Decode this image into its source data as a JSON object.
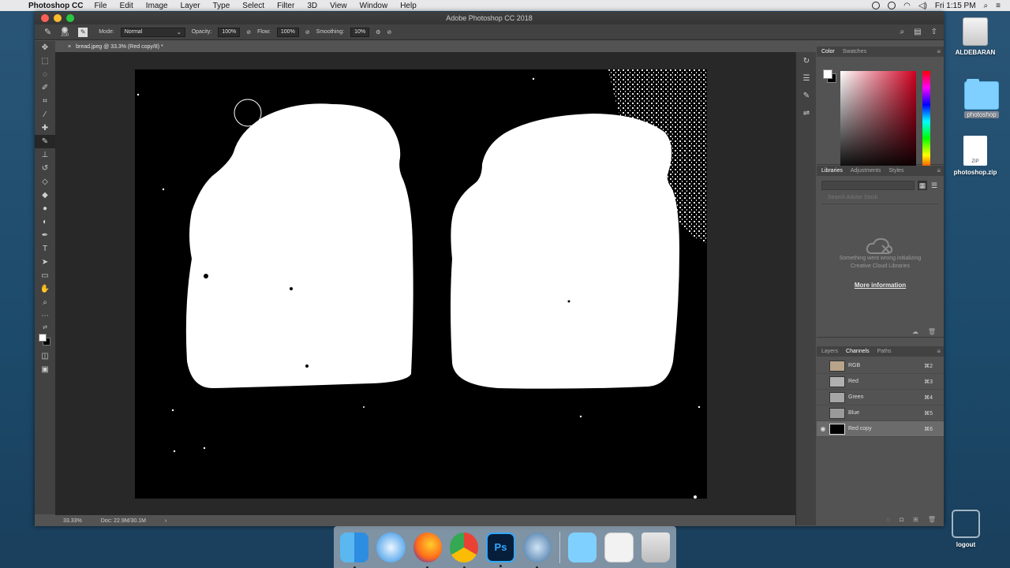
{
  "menubar": {
    "app_name": "Photoshop CC",
    "items": [
      "File",
      "Edit",
      "Image",
      "Layer",
      "Type",
      "Select",
      "Filter",
      "3D",
      "View",
      "Window",
      "Help"
    ],
    "clock": "Fri 1:15 PM"
  },
  "window": {
    "title": "Adobe Photoshop CC 2018"
  },
  "options_bar": {
    "brush_size": "200",
    "mode_label": "Mode:",
    "mode_value": "Normal",
    "opacity_label": "Opacity:",
    "opacity_value": "100%",
    "flow_label": "Flow:",
    "flow_value": "100%",
    "smoothing_label": "Smoothing:",
    "smoothing_value": "10%"
  },
  "document": {
    "tab_title": "bread.jpeg @ 33.3% (Red copy/8) *",
    "close_glyph": "×"
  },
  "statusbar": {
    "zoom": "33.33%",
    "doc_size": "Doc: 22.9M/30.1M",
    "arrow": "›"
  },
  "color_panel": {
    "tabs": [
      "Color",
      "Swatches"
    ]
  },
  "libraries_panel": {
    "tabs": [
      "Libraries",
      "Adjustments",
      "Styles"
    ],
    "search_placeholder": "Search Adobe Stock",
    "message_line1": "Something went wrong initializing",
    "message_line2": "Creative Cloud Libraries",
    "link": "More information"
  },
  "channels_panel": {
    "tabs": [
      "Layers",
      "Channels",
      "Paths"
    ],
    "channels": [
      {
        "name": "RGB",
        "shortcut": "⌘2"
      },
      {
        "name": "Red",
        "shortcut": "⌘3"
      },
      {
        "name": "Green",
        "shortcut": "⌘4"
      },
      {
        "name": "Blue",
        "shortcut": "⌘5"
      },
      {
        "name": "Red copy",
        "shortcut": "⌘6"
      }
    ]
  },
  "desktop": {
    "drive_label": "ALDEBARAN",
    "folder_label": "photoshop",
    "zip_label": "photoshop.zip",
    "zip_badge": "ZIP",
    "logout_label": "logout"
  },
  "dock": {
    "ps_label": "Ps"
  }
}
